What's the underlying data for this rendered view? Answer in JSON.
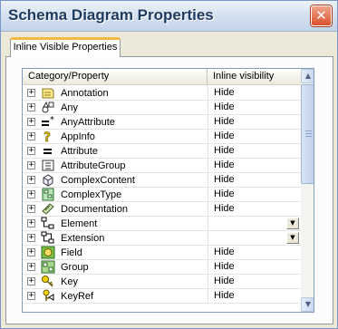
{
  "window": {
    "title": "Schema Diagram Properties",
    "close_glyph": "✕"
  },
  "tabs": [
    {
      "label": "Inline Visible Properties",
      "selected": true
    }
  ],
  "grid": {
    "columns": [
      "Category/Property",
      "Inline visibility"
    ],
    "rows": [
      {
        "name": "Annotation",
        "icon": "annotation-icon",
        "visibility": "Hide",
        "dropdown": false
      },
      {
        "name": "Any",
        "icon": "any-icon",
        "visibility": "Hide",
        "dropdown": false
      },
      {
        "name": "AnyAttribute",
        "icon": "any-attribute-icon",
        "visibility": "Hide",
        "dropdown": false
      },
      {
        "name": "AppInfo",
        "icon": "appinfo-icon",
        "visibility": "Hide",
        "dropdown": false
      },
      {
        "name": "Attribute",
        "icon": "attribute-icon",
        "visibility": "Hide",
        "dropdown": false
      },
      {
        "name": "AttributeGroup",
        "icon": "attribute-group-icon",
        "visibility": "Hide",
        "dropdown": false
      },
      {
        "name": "ComplexContent",
        "icon": "complex-content-icon",
        "visibility": "Hide",
        "dropdown": false
      },
      {
        "name": "ComplexType",
        "icon": "complex-type-icon",
        "visibility": "Hide",
        "dropdown": false
      },
      {
        "name": "Documentation",
        "icon": "documentation-icon",
        "visibility": "Hide",
        "dropdown": false
      },
      {
        "name": "Element",
        "icon": "element-icon",
        "visibility": "",
        "dropdown": true
      },
      {
        "name": "Extension",
        "icon": "extension-icon",
        "visibility": "",
        "dropdown": true
      },
      {
        "name": "Field",
        "icon": "field-icon",
        "visibility": "Hide",
        "dropdown": false
      },
      {
        "name": "Group",
        "icon": "group-icon",
        "visibility": "Hide",
        "dropdown": false
      },
      {
        "name": "Key",
        "icon": "key-icon",
        "visibility": "Hide",
        "dropdown": false
      },
      {
        "name": "KeyRef",
        "icon": "keyref-icon",
        "visibility": "Hide",
        "dropdown": false
      }
    ]
  },
  "expander_glyph": "+",
  "scrollbar": {
    "up_glyph": "▲",
    "down_glyph": "▼"
  },
  "combo_glyph": "▼"
}
